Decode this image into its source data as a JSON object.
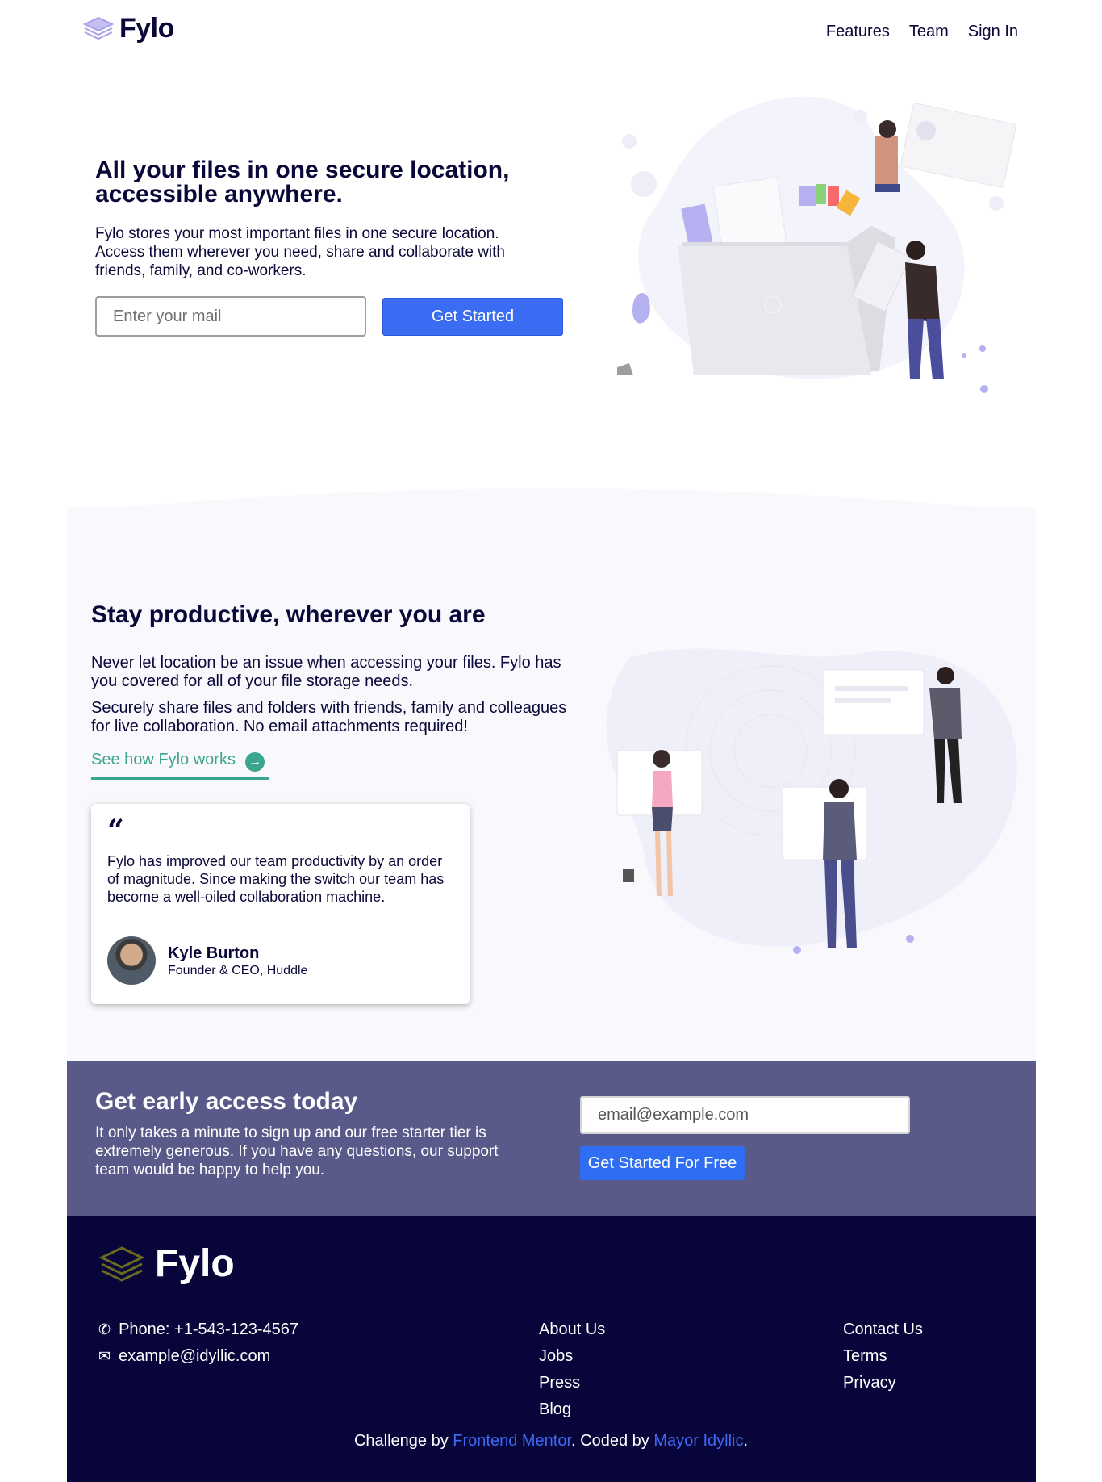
{
  "header": {
    "logo_text": "Fylo",
    "nav": [
      "Features",
      "Team",
      "Sign In"
    ]
  },
  "hero": {
    "title": "All your files in one secure location, accessible anywhere.",
    "description": "Fylo stores your most important files in one secure location. Access them wherever you need, share and collaborate with friends, family, and co-workers.",
    "email_placeholder": "Enter your mail",
    "cta_label": "Get Started"
  },
  "productive": {
    "title": "Stay productive, wherever you are",
    "p1": "Never let location be an issue when accessing your files. Fylo has you covered for all of your file storage needs.",
    "p2": "Securely share files and folders with friends, family and colleagues for live collaboration. No email attachments required!",
    "link_label": "See how Fylo works",
    "testimonial": {
      "quote": "Fylo has improved our team productivity by an order of magnitude. Since making the switch our team has become a well-oiled collaboration machine.",
      "name": "Kyle Burton",
      "role": "Founder & CEO, Huddle"
    }
  },
  "early_access": {
    "title": "Get early access today",
    "description": "It only takes a minute to sign up and our free starter tier is extremely generous. If you have any questions, our support team would be happy to help you.",
    "email_placeholder": "email@example.com",
    "cta_label": "Get Started For Free"
  },
  "footer": {
    "logo_text": "Fylo",
    "phone": "Phone: +1-543-123-4567",
    "email": "example@idyllic.com",
    "links_col1": [
      "About Us",
      "Jobs",
      "Press",
      "Blog"
    ],
    "links_col2": [
      "Contact Us",
      "Terms",
      "Privacy"
    ],
    "credit_prefix": "Challenge by ",
    "credit_fm": "Frontend Mentor",
    "credit_mid": ". Coded by ",
    "credit_author": "Mayor Idyllic",
    "credit_suffix": "."
  },
  "colors": {
    "primary_blue": "#3a6cf4",
    "navy": "#0a0838",
    "teal": "#3ba68f",
    "early_bg": "#5a5a8a",
    "footer_bg": "#070539"
  }
}
